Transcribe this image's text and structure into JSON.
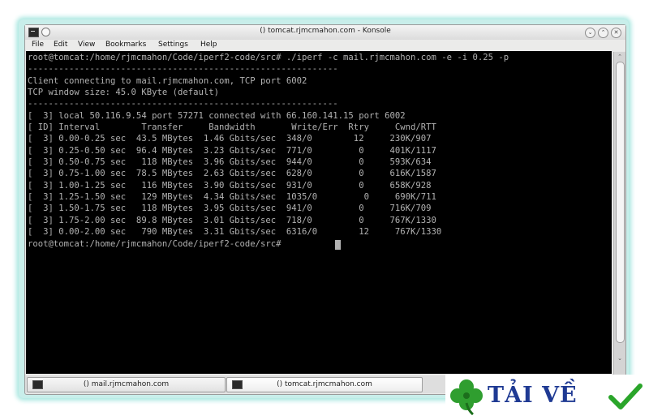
{
  "window": {
    "title": "() tomcat.rjmcmahon.com - Konsole",
    "controls": {
      "minimize": "⌄",
      "maximize": "⌃",
      "close": "✕"
    }
  },
  "menu": [
    "File",
    "Edit",
    "View",
    "Bookmarks",
    "Settings",
    "Help"
  ],
  "terminal": {
    "lines": [
      "root@tomcat:/home/rjmcmahon/Code/iperf2-code/src# ./iperf -c mail.rjmcmahon.com -e -i 0.25 -p",
      "------------------------------------------------------------",
      "Client connecting to mail.rjmcmahon.com, TCP port 6002",
      "TCP window size: 45.0 KByte (default)",
      "------------------------------------------------------------",
      "[  3] local 50.116.9.54 port 57271 connected with 66.160.141.15 port 6002",
      "[ ID] Interval        Transfer     Bandwidth       Write/Err  Rtry     Cwnd/RTT",
      "[  3] 0.00-0.25 sec  43.5 MBytes  1.46 Gbits/sec  348/0        12     230K/907",
      "[  3] 0.25-0.50 sec  96.4 MBytes  3.23 Gbits/sec  771/0         0     401K/1117",
      "[  3] 0.50-0.75 sec   118 MBytes  3.96 Gbits/sec  944/0         0     593K/634",
      "[  3] 0.75-1.00 sec  78.5 MBytes  2.63 Gbits/sec  628/0         0     616K/1587",
      "[  3] 1.00-1.25 sec   116 MBytes  3.90 Gbits/sec  931/0         0     658K/928",
      "[  3] 1.25-1.50 sec   129 MBytes  4.34 Gbits/sec  1035/0         0     690K/711",
      "[  3] 1.50-1.75 sec   118 MBytes  3.95 Gbits/sec  941/0         0     716K/709",
      "[  3] 1.75-2.00 sec  89.8 MBytes  3.01 Gbits/sec  718/0         0     767K/1330",
      "[  3] 0.00-2.00 sec   790 MBytes  3.31 Gbits/sec  6316/0        12     767K/1330",
      "root@tomcat:/home/rjmcmahon/Code/iperf2-code/src# "
    ]
  },
  "scrollbar": {
    "up": "⌃",
    "down": "⌄"
  },
  "tabs": [
    {
      "label": "() mail.rjmcmahon.com"
    },
    {
      "label": "() tomcat.rjmcmahon.com"
    }
  ],
  "watermark": {
    "text": "TẢI VỀ"
  }
}
